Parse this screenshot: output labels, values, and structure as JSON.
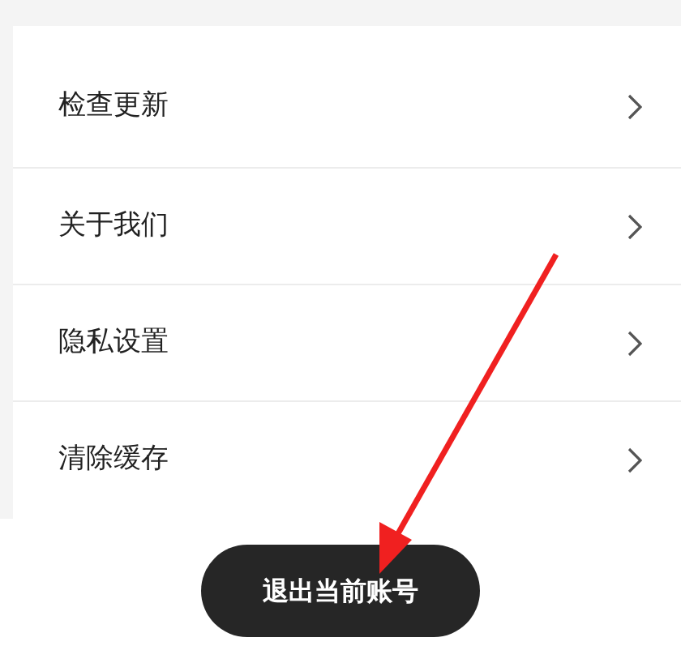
{
  "settings": [
    {
      "label": "检查更新"
    },
    {
      "label": "关于我们"
    },
    {
      "label": "隐私设置"
    },
    {
      "label": "清除缓存"
    }
  ],
  "logout_button": {
    "label": "退出当前账号"
  },
  "annotation": {
    "kind": "arrow"
  }
}
